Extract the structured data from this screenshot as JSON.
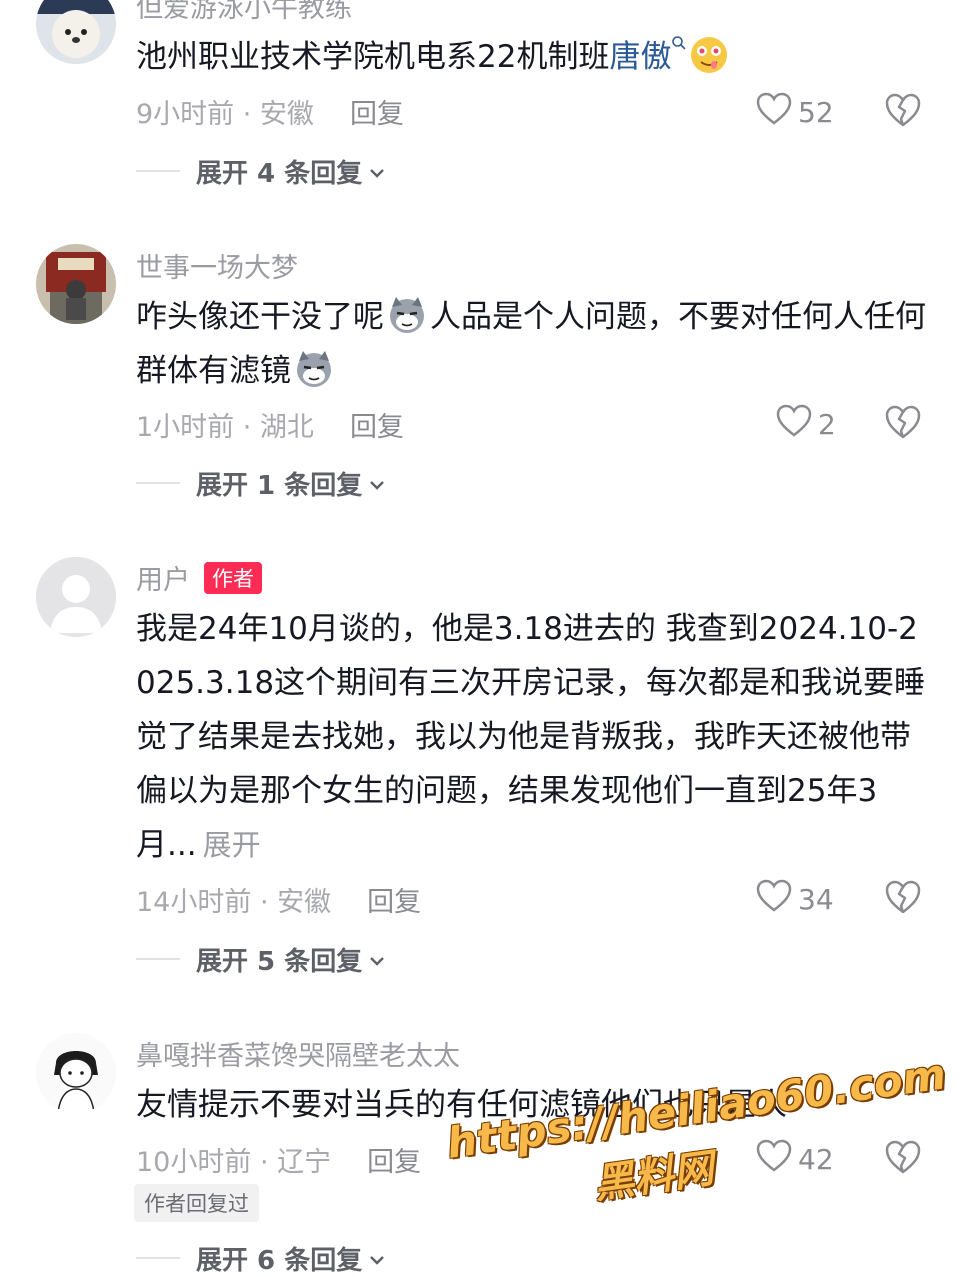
{
  "comments": [
    {
      "username": "但爱游泳小牛教练",
      "text": "池州职业技术学院机电系22机制班",
      "link": "唐傲",
      "time": "9小时前 · 安徽",
      "reply": "回复",
      "likes": "52",
      "expand": "展开 4 条回复"
    },
    {
      "username": "世事一场大梦",
      "text_a": "咋头像还干没了呢",
      "text_b": "人品是个人问题，不要对任何人任何群体有滤镜",
      "time": "1小时前 · 湖北",
      "reply": "回复",
      "likes": "2",
      "expand": "展开 1 条回复"
    },
    {
      "username": "用户",
      "author_tag": "作者",
      "text": "我是24年10月谈的，他是3.18进去的 我查到2024.10-2025.3.18这个期间有三次开房记录，每次都是和我说要睡觉了结果是去找她，我以为他是背叛我，我昨天还被他带偏以为是那个女生的问题，结果发现他们一直到25年3月...",
      "expand_inline": "展开",
      "time": "14小时前 · 安徽",
      "reply": "回复",
      "likes": "34",
      "expand": "展开 5 条回复"
    },
    {
      "username": "鼻嘎拌香菜馋哭隔壁老太太",
      "text": "友情提示不要对当兵的有任何滤镜他们也只是人",
      "time": "10小时前 · 辽宁",
      "reply": "回复",
      "likes": "42",
      "author_replied": "作者回复过",
      "expand": "展开 6 条回复"
    }
  ],
  "watermark": {
    "url": "https://heiliao60.com",
    "name": "黑料网"
  },
  "colors": {
    "accent": "#fe2c55",
    "link": "#2a5a98",
    "meta": "#a8a9af"
  }
}
